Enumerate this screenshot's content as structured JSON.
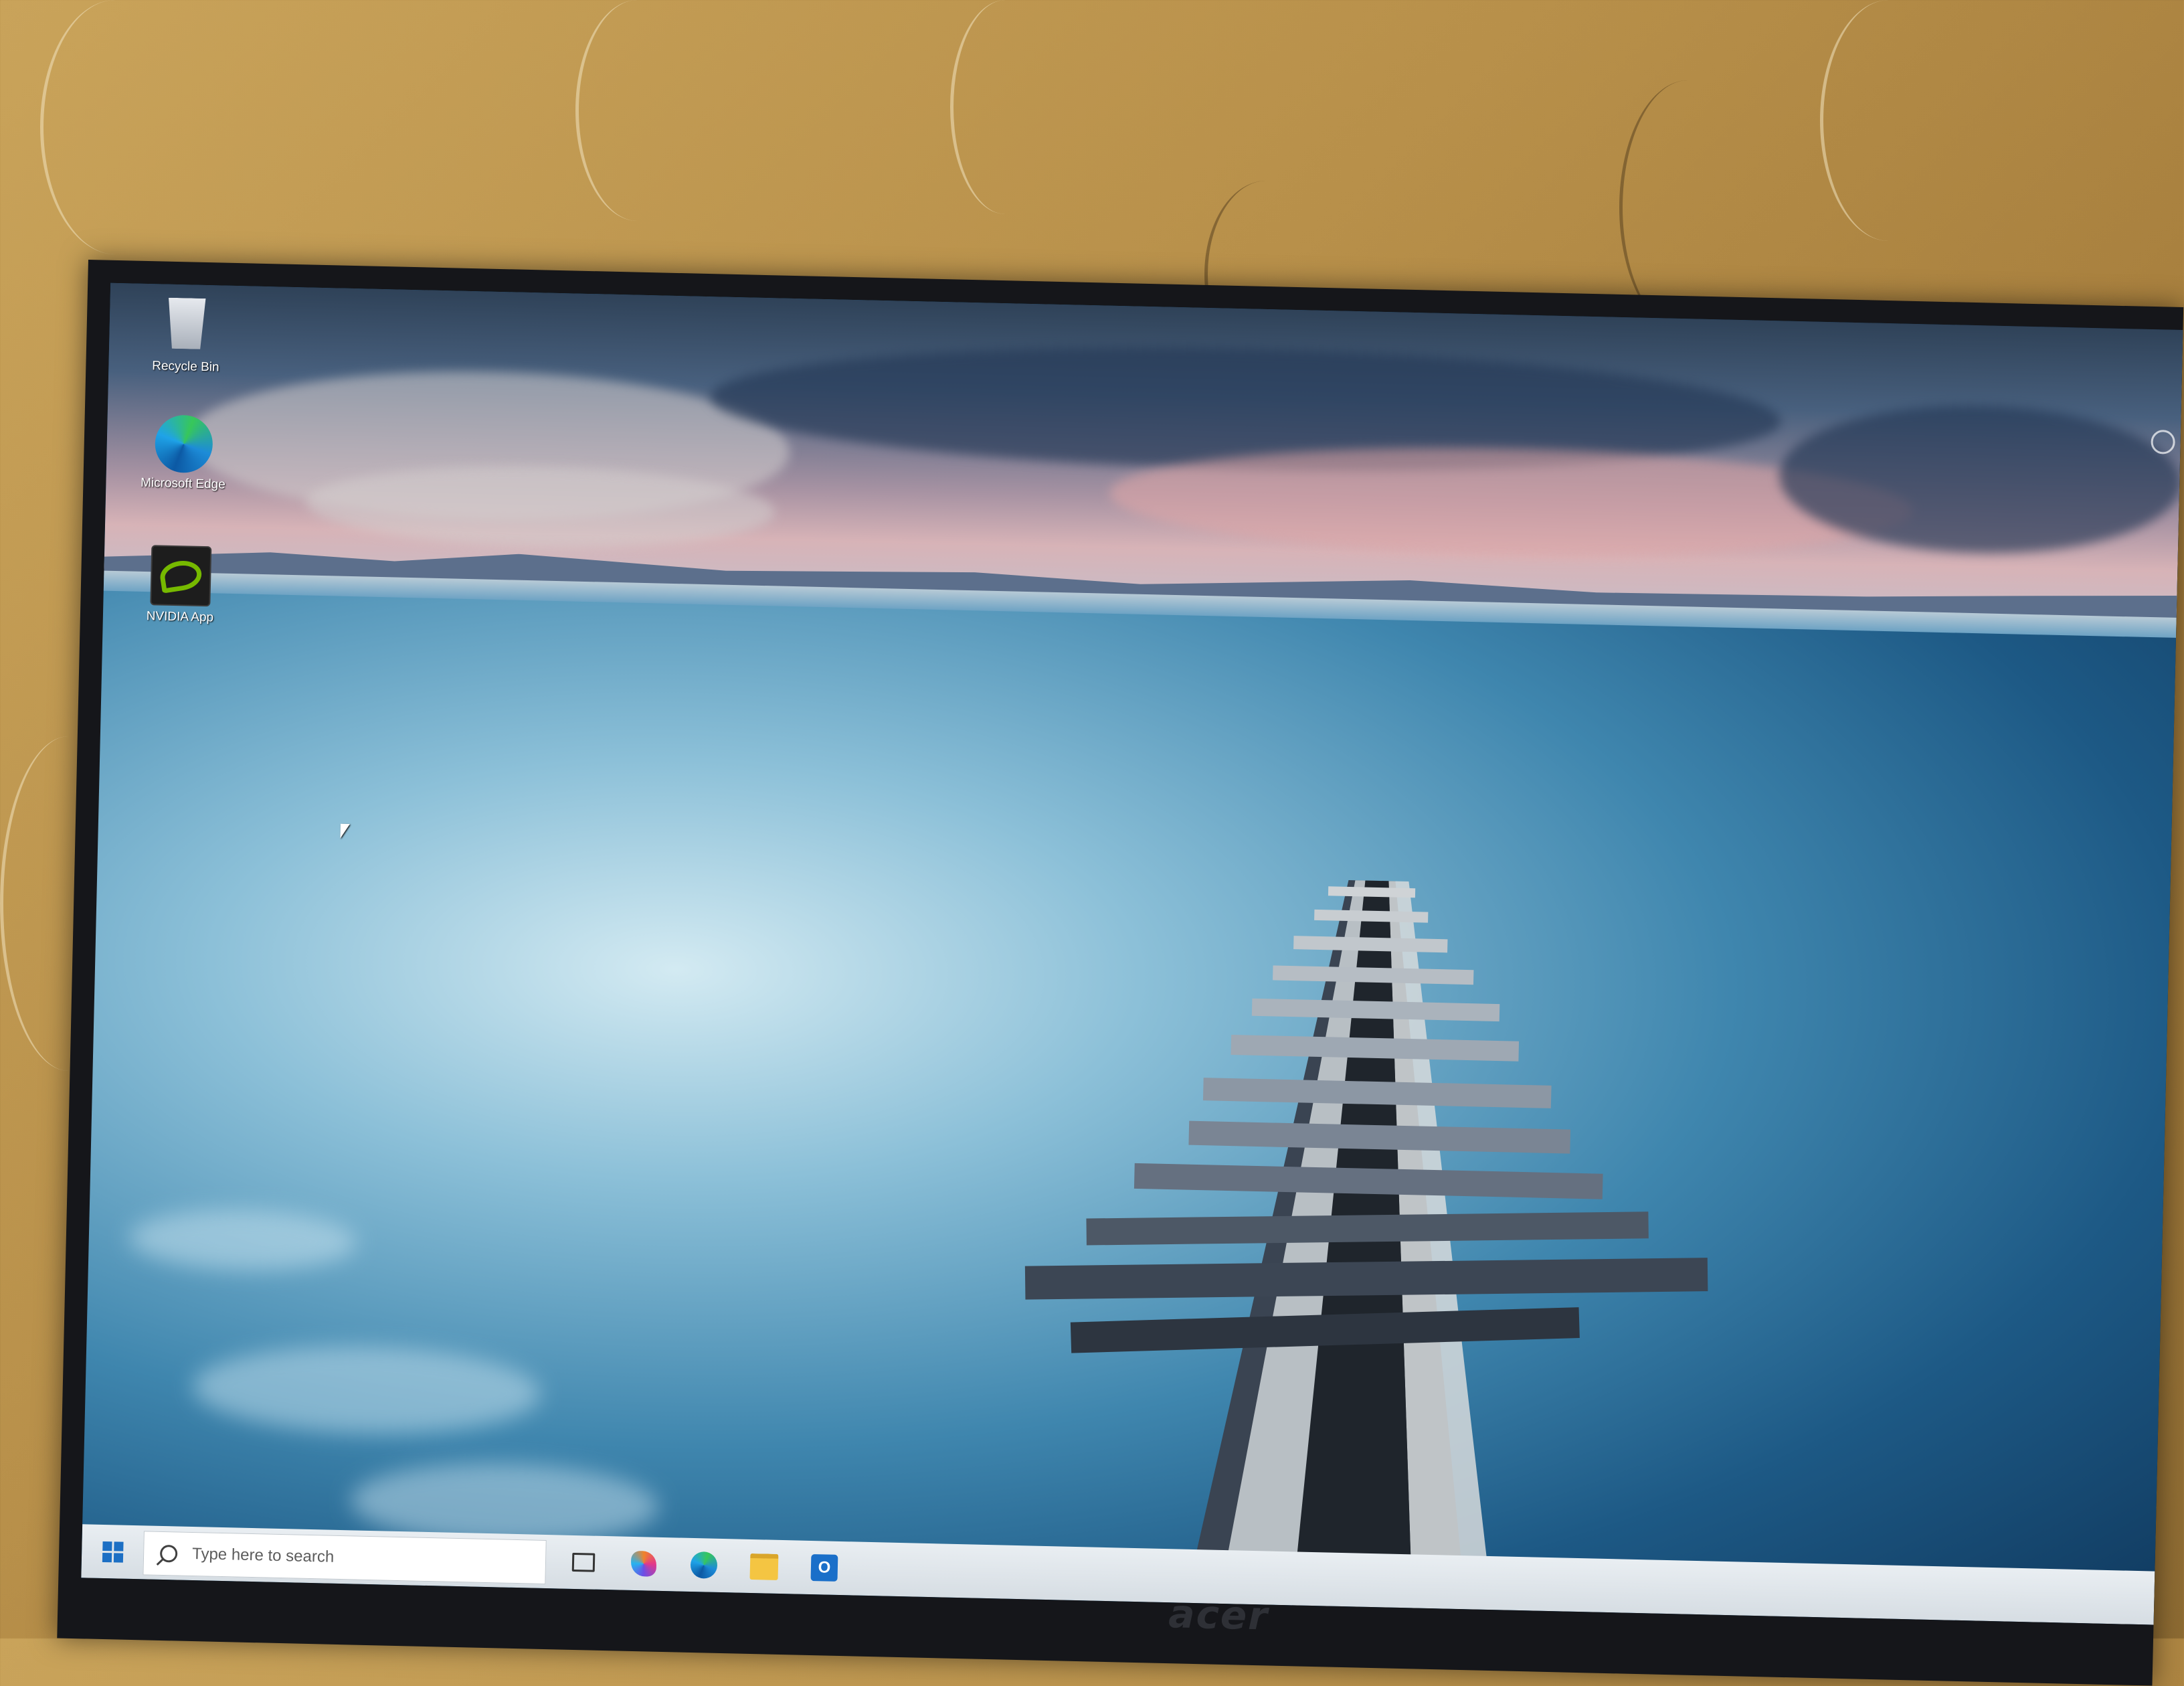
{
  "desktop": {
    "icons": [
      {
        "label": "Recycle Bin",
        "icon": "recycle-bin-icon"
      },
      {
        "label": "Microsoft Edge",
        "icon": "edge-icon"
      },
      {
        "label": "NVIDIA App",
        "icon": "nvidia-icon"
      }
    ]
  },
  "taskbar": {
    "search_placeholder": "Type here to search",
    "pinned_apps": [
      "task-view-icon",
      "copilot-icon",
      "edge-icon",
      "file-explorer-icon",
      "outlook-icon"
    ]
  },
  "monitor": {
    "brand": "acer"
  },
  "colors": {
    "taskbar": "#e9eef2",
    "windows_blue": "#1c6fc4",
    "wall": "#b8904a"
  }
}
